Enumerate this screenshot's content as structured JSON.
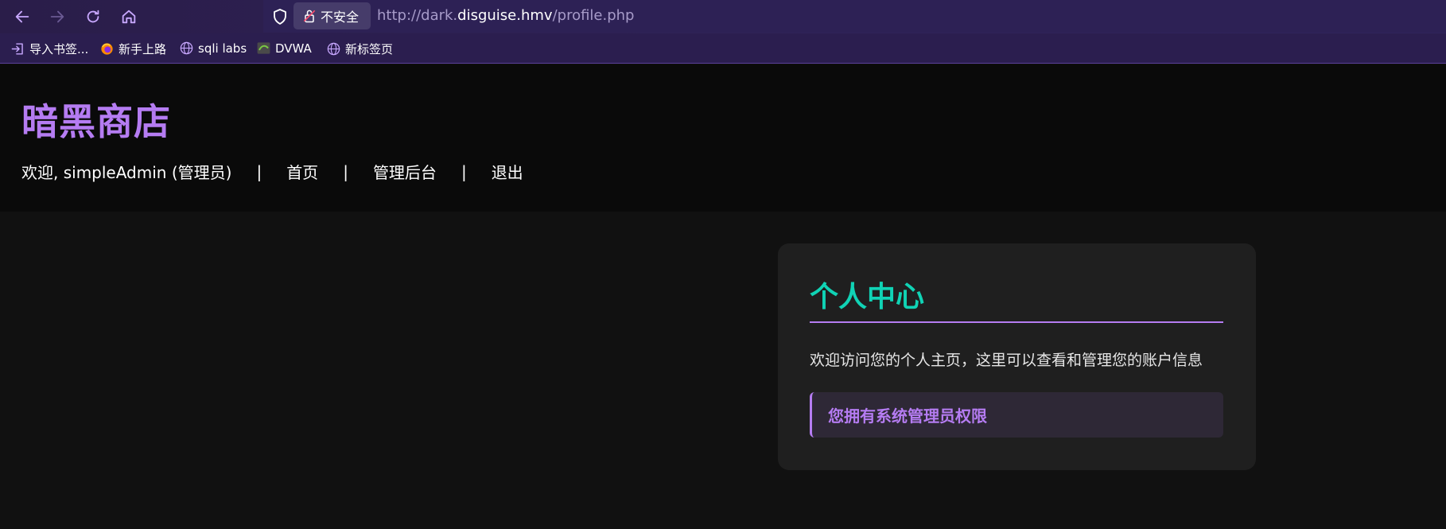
{
  "browser": {
    "security_label": "不安全",
    "url_prefix": "http://dark.",
    "url_host": "disguise.hmv",
    "url_path": "/profile.php",
    "bookmarks": [
      {
        "label": "导入书签...",
        "icon": "import-icon"
      },
      {
        "label": "新手上路",
        "icon": "firefox-icon"
      },
      {
        "label": "sqli labs",
        "icon": "globe-icon"
      },
      {
        "label": "DVWA",
        "icon": "dvwa-icon"
      },
      {
        "label": "新标签页",
        "icon": "globe-icon"
      }
    ]
  },
  "header": {
    "site_title": "暗黑商店",
    "nav": {
      "welcome": "欢迎, simpleAdmin (管理员)",
      "separator": "|",
      "home": "首页",
      "admin": "管理后台",
      "logout": "退出"
    }
  },
  "profile": {
    "title": "个人中心",
    "description": "欢迎访问您的个人主页，这里可以查看和管理您的账户信息",
    "admin_notice": "您拥有系统管理员权限"
  },
  "colors": {
    "accent": "#b57cf2",
    "title_teal": "#10d3b5",
    "page_bg": "#111111",
    "card_bg": "#1f1f1f"
  }
}
